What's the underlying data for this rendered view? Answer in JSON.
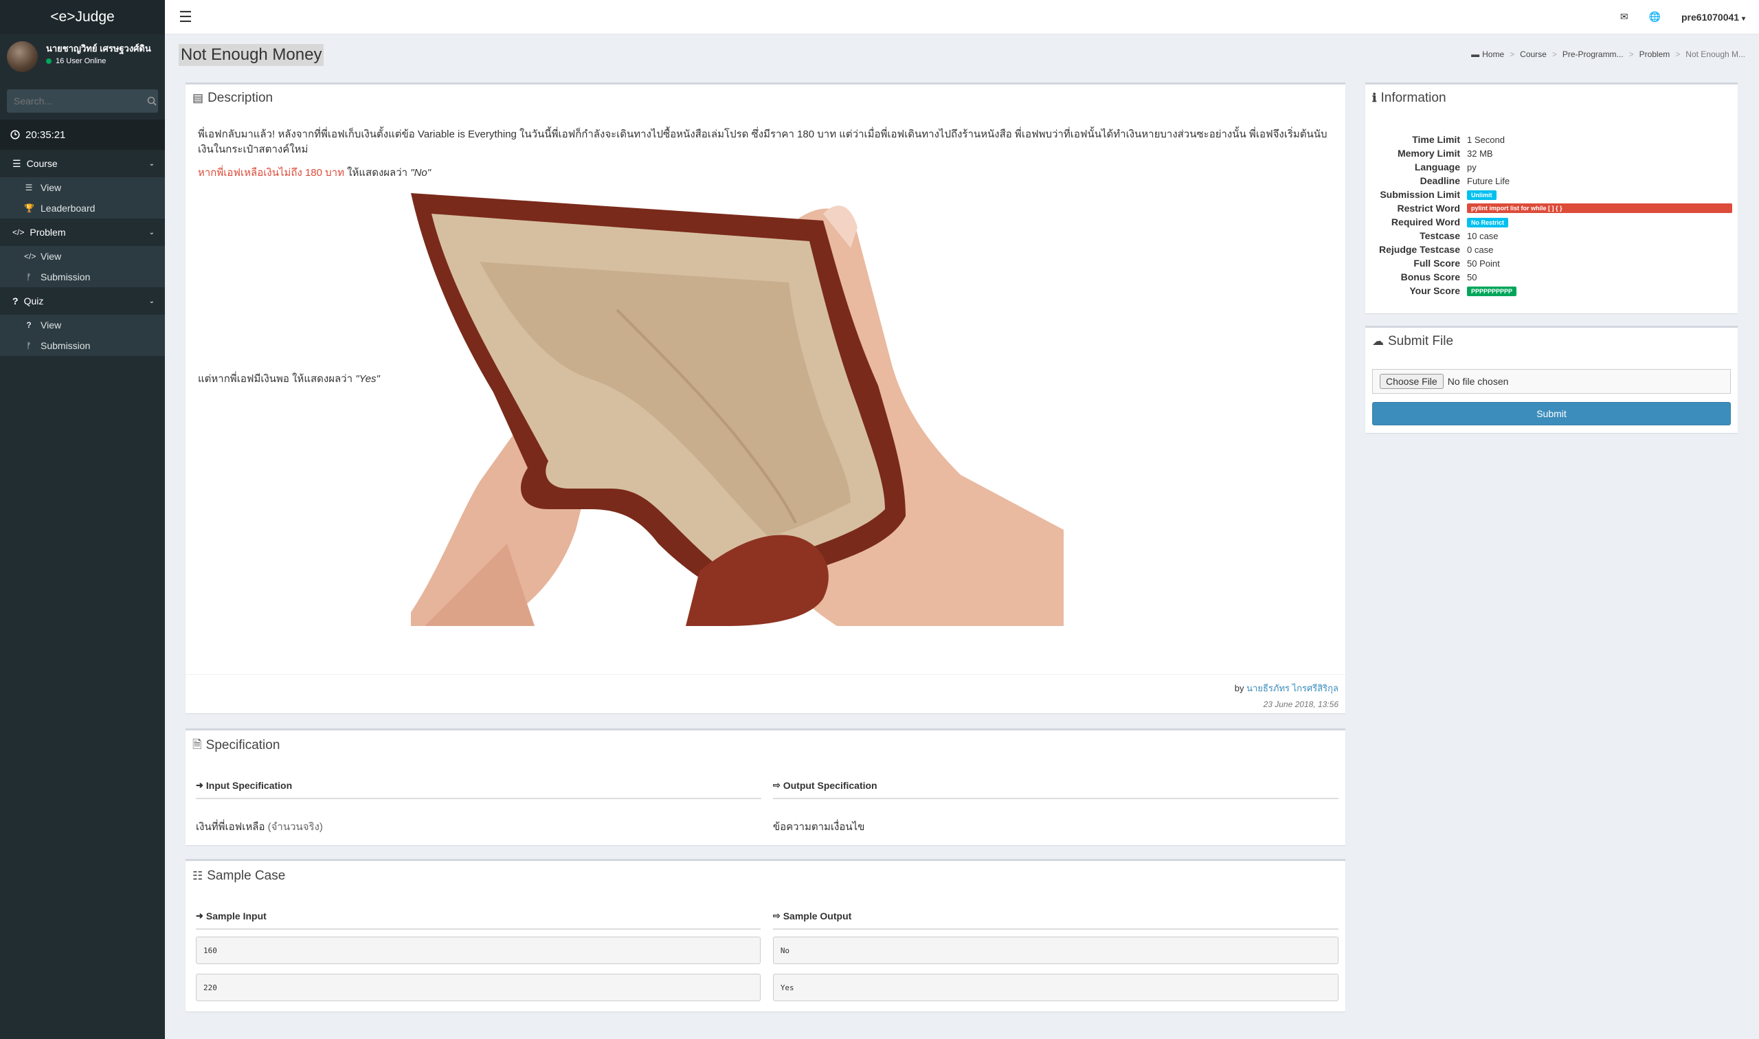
{
  "app": {
    "brand": "<e>Judge"
  },
  "user": {
    "name": "นายชาญวิทย์ เศรษฐวงศ์ดิน",
    "online": "16 User Online",
    "username": "pre61070041"
  },
  "search": {
    "placeholder": "Search..."
  },
  "clock": "20:35:21",
  "menu": {
    "course": {
      "label": "Course",
      "items": [
        "View",
        "Leaderboard"
      ]
    },
    "problem": {
      "label": "Problem",
      "items": [
        "View",
        "Submission"
      ]
    },
    "quiz": {
      "label": "Quiz",
      "items": [
        "View",
        "Submission"
      ]
    }
  },
  "page": {
    "title": "Not Enough Money"
  },
  "breadcrumb": [
    "Home",
    "Course",
    "Pre-Programm...",
    "Problem",
    "Not Enough M..."
  ],
  "description": {
    "title": "Description",
    "p1": "พี่เอฟกลับมาแล้ว! หลังจากที่พี่เอฟเก็บเงินตั้งแต่ข้อ Variable is Everything ในวันนี้พี่เอฟก็กำลังจะเดินทางไปซื้อหนังสือเล่มโปรด ซึ่งมีราคา 180 บาท แต่ว่าเมื่อพี่เอฟเดินทางไปถึงร้านหนังสือ พี่เอฟพบว่าที่เอฟนั้นได้ทำเงินหายบางส่วนซะอย่างนั้น พี่เอฟจึงเริ่มต้นนับเงินในกระเป๋าสตางค์ใหม่",
    "no_red": "หากพี่เอฟเหลือเงินไม่ถึง 180 บาท",
    "no_rest": " ให้แสดงผลว่า ",
    "no_value": "\"No\"",
    "yes_text": "แต่หากพี่เอฟมีเงินพอ ให้แสดงผลว่า ",
    "yes_value": "\"Yes\"",
    "by": "by",
    "author": "นายธีรภัทร ไกรศรีสิริกุล",
    "date": "23 June 2018, 13:56"
  },
  "specification": {
    "title": "Specification",
    "input_head": "Input Specification",
    "input_value": "เงินที่พี่เอฟเหลือ",
    "input_note": "(จำนวนจริง)",
    "output_head": "Output Specification",
    "output_value": "ข้อความตามเงื่อนไข"
  },
  "sample": {
    "title": "Sample Case",
    "input_head": "Sample Input",
    "output_head": "Sample Output",
    "rows": [
      {
        "input": "160",
        "output": "No"
      },
      {
        "input": "220",
        "output": "Yes"
      }
    ]
  },
  "information": {
    "title": "Information",
    "rows": [
      {
        "key": "Time Limit",
        "value": "1 Second"
      },
      {
        "key": "Memory Limit",
        "value": "32 MB"
      },
      {
        "key": "Language",
        "value": "py"
      },
      {
        "key": "Deadline",
        "value": "Future Life"
      },
      {
        "key": "Submission Limit",
        "badge": "Unlimit"
      },
      {
        "key": "Restrict Word",
        "badge": "pylint import list for while [ ] { }"
      },
      {
        "key": "Required Word",
        "badge": "No Restrict"
      },
      {
        "key": "Testcase",
        "value": "10 case"
      },
      {
        "key": "Rejudge Testcase",
        "value": "0 case"
      },
      {
        "key": "Full Score",
        "value": "50 Point"
      },
      {
        "key": "Bonus Score",
        "value": "50"
      },
      {
        "key": "Your Score",
        "badge": "PPPPPPPPPP"
      }
    ]
  },
  "submit": {
    "title": "Submit File",
    "choose_label": "Choose File",
    "no_file": "No file chosen",
    "submit_label": "Submit"
  },
  "colors": {
    "sidebar": "#222d32",
    "accent": "#3c8dbc",
    "danger": "#dd4b39",
    "success": "#00a65a",
    "info": "#00c0ef"
  }
}
